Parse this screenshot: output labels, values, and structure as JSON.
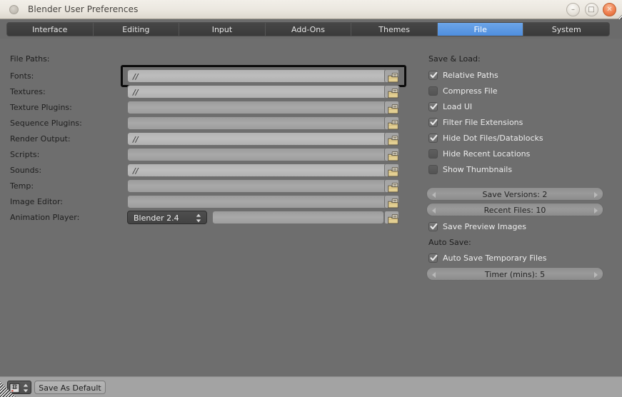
{
  "window": {
    "title": "Blender User Preferences",
    "app_icon": "blender-circle-icon",
    "minimize_glyph": "–",
    "maximize_glyph": "□",
    "close_glyph": "✕"
  },
  "tabs": [
    {
      "label": "Interface",
      "active": false
    },
    {
      "label": "Editing",
      "active": false
    },
    {
      "label": "Input",
      "active": false
    },
    {
      "label": "Add-Ons",
      "active": false
    },
    {
      "label": "Themes",
      "active": false
    },
    {
      "label": "File",
      "active": true
    },
    {
      "label": "System",
      "active": false
    }
  ],
  "left_panel": {
    "heading": "File Paths:",
    "rows": [
      {
        "label": "Fonts:",
        "value": "//",
        "placeholder": "",
        "focused": true,
        "browse": true
      },
      {
        "label": "Textures:",
        "value": "//",
        "placeholder": "",
        "focused": false,
        "browse": true
      },
      {
        "label": "Texture Plugins:",
        "value": "",
        "placeholder": "",
        "focused": false,
        "browse": true
      },
      {
        "label": "Sequence Plugins:",
        "value": "",
        "placeholder": "",
        "focused": false,
        "browse": true
      },
      {
        "label": "Render Output:",
        "value": "//",
        "placeholder": "",
        "focused": false,
        "browse": true
      },
      {
        "label": "Scripts:",
        "value": "",
        "placeholder": "",
        "focused": false,
        "browse": true
      },
      {
        "label": "Sounds:",
        "value": "//",
        "placeholder": "",
        "focused": false,
        "browse": true
      },
      {
        "label": "Temp:",
        "value": "",
        "placeholder": "",
        "focused": false,
        "browse": true
      },
      {
        "label": "Image Editor:",
        "value": "",
        "placeholder": "",
        "focused": false,
        "browse": true
      }
    ],
    "animation_player": {
      "label": "Animation Player:",
      "dropdown_value": "Blender 2.4",
      "path_value": "",
      "browse": true
    }
  },
  "right_panel": {
    "save_load_heading": "Save & Load:",
    "checkboxes": [
      {
        "label": "Relative Paths",
        "checked": true
      },
      {
        "label": "Compress File",
        "checked": false
      },
      {
        "label": "Load UI",
        "checked": true
      },
      {
        "label": "Filter File Extensions",
        "checked": true
      },
      {
        "label": "Hide Dot Files/Datablocks",
        "checked": true
      },
      {
        "label": "Hide Recent Locations",
        "checked": false
      },
      {
        "label": "Show Thumbnails",
        "checked": false
      }
    ],
    "sliders": [
      {
        "label": "Save Versions: 2",
        "name": "Save Versions",
        "value": 2
      },
      {
        "label": "Recent Files: 10",
        "name": "Recent Files",
        "value": 10
      }
    ],
    "save_preview": {
      "label": "Save Preview Images",
      "checked": true
    },
    "auto_save_heading": "Auto Save:",
    "auto_save_temp": {
      "label": "Auto Save Temporary Files",
      "checked": true
    },
    "timer_slider": {
      "label": "Timer (mins): 5",
      "name": "Timer (mins)",
      "value": 5
    }
  },
  "footer": {
    "editor_type_icon": "user-preferences-editor-icon",
    "save_as_default_label": "Save As Default"
  },
  "colors": {
    "accent_tab_active": "#4f8ede",
    "window_chrome": "#ebe7df",
    "panel_bg": "#6e6e6e",
    "footer_bg": "#a3a3a3",
    "close_button": "#ef8050",
    "field_bg": "#a9a9a9",
    "focus_ring": "#0b0b0b"
  }
}
